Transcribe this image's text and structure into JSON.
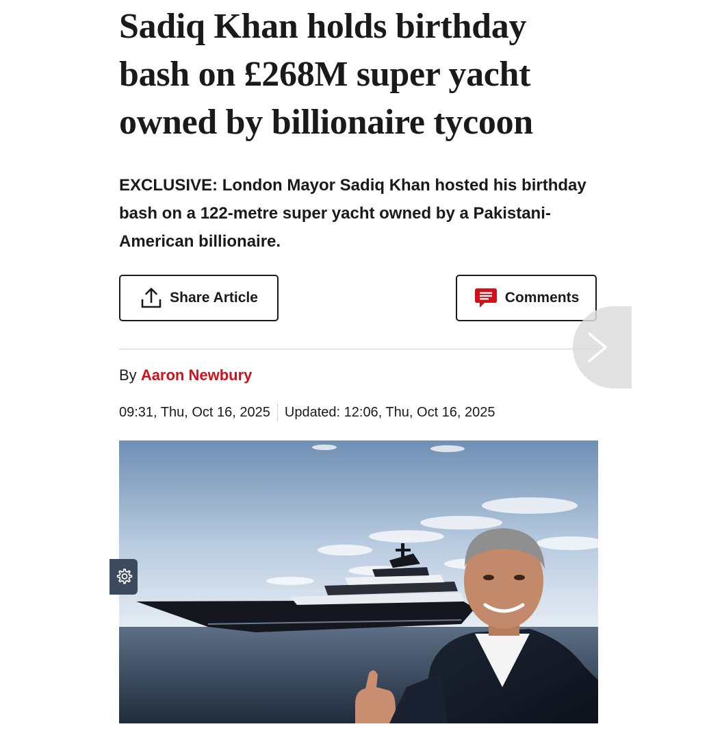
{
  "article": {
    "headline": "Sadiq Khan holds birthday bash on £268M super yacht owned by billionaire tycoon",
    "standfirst": "EXCLUSIVE: London Mayor Sadiq Khan hosted his birthday bash on a 122-metre super yacht owned by a Pakistani-American billionaire.",
    "byline_prefix": "By",
    "author": "Aaron Newbury",
    "published": "09:31, Thu, Oct 16, 2025",
    "updated": "Updated: 12:06, Thu, Oct 16, 2025"
  },
  "actions": {
    "share_label": "Share Article",
    "comments_label": "Comments"
  },
  "icons": {
    "share": "share-icon",
    "comments": "comment-icon",
    "next": "chevron-right-icon",
    "settings": "gear-icon"
  },
  "colors": {
    "author_link": "#d3101a",
    "comment_icon": "#d3101a",
    "settings_tab": "#3b4a5c"
  }
}
